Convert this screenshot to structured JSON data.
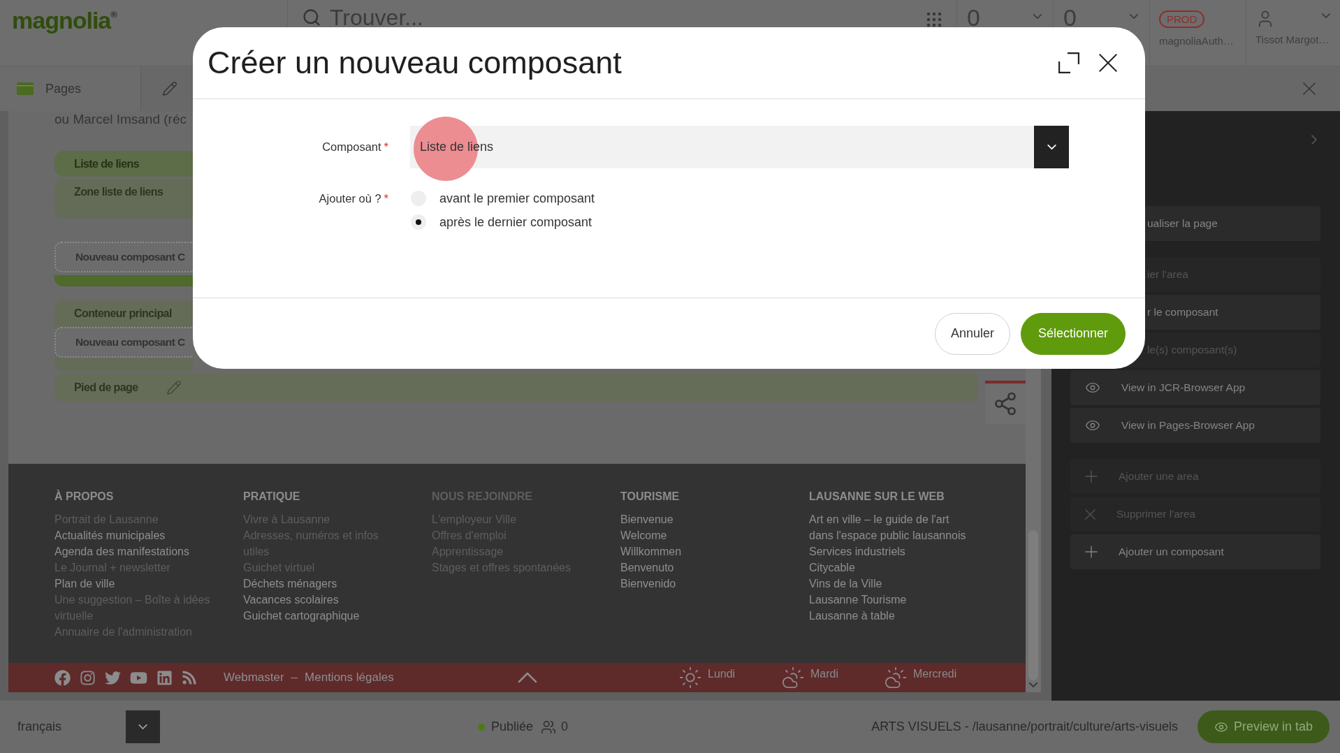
{
  "header": {
    "logo": "magnolia$^{®}$",
    "search": {
      "placeholder": "Trouver..."
    },
    "counters": [
      {
        "value": "0"
      },
      {
        "value": "0"
      }
    ],
    "environment": {
      "badge": "PROD",
      "account": "magnoliaAuth…"
    },
    "user": {
      "name": "Tissot Margot…"
    }
  },
  "tabs": [
    {
      "kind": "app",
      "label": "Pages"
    },
    {
      "kind": "edit"
    }
  ],
  "page_preview": {
    "intro_text": "ou Marcel Imsand (réc",
    "blocks": [
      {
        "kind": "component",
        "label": "Liste de liens"
      },
      {
        "kind": "area",
        "label": "Zone liste de liens"
      },
      {
        "kind": "placeholder",
        "label": "Nouveau composant C",
        "highlighted": true
      },
      {
        "kind": "area",
        "label": "Conteneur principal",
        "children": [
          {
            "kind": "placeholder",
            "label": "Nouveau composant C",
            "highlighted": false
          }
        ]
      },
      {
        "kind": "footer",
        "label": "Pied de page"
      }
    ],
    "footer": {
      "columns": [
        {
          "heading": "À PROPOS",
          "dimmed": false,
          "links": [
            {
              "text": "Portrait de Lausanne",
              "dimmed": true
            },
            {
              "text": "Actualités municipales",
              "dimmed": false
            },
            {
              "text": "Agenda des manifestations",
              "dimmed": false
            },
            {
              "text": "Le Journal + newsletter",
              "dimmed": true
            },
            {
              "text": "Plan de ville",
              "dimmed": false
            },
            {
              "text": "Une suggestion – Boîte à idées virtuelle",
              "dimmed": true
            },
            {
              "text": "Annuaire de l'administration",
              "dimmed": true
            }
          ]
        },
        {
          "heading": "PRATIQUE",
          "dimmed": false,
          "links": [
            {
              "text": "Vivre à Lausanne",
              "dimmed": true
            },
            {
              "text": "Adresses, numéros et infos utiles",
              "dimmed": true
            },
            {
              "text": "Guichet virtuel",
              "dimmed": true
            },
            {
              "text": "Déchets ménagers",
              "dimmed": false
            },
            {
              "text": "Vacances scolaires",
              "dimmed": false
            },
            {
              "text": "Guichet cartographique",
              "dimmed": false
            }
          ]
        },
        {
          "heading": "NOUS REJOINDRE",
          "dimmed": true,
          "links": [
            {
              "text": "L'employeur Ville",
              "dimmed": true
            },
            {
              "text": "Offres d'emploi",
              "dimmed": true
            },
            {
              "text": "Apprentissage",
              "dimmed": true
            },
            {
              "text": "Stages et offres spontanées",
              "dimmed": true
            }
          ]
        },
        {
          "heading": "TOURISME",
          "dimmed": false,
          "links": [
            {
              "text": "Bienvenue",
              "dimmed": false
            },
            {
              "text": "Welcome",
              "dimmed": false
            },
            {
              "text": "Willkommen",
              "dimmed": false
            },
            {
              "text": "Benvenuto",
              "dimmed": false
            },
            {
              "text": "Bienvenido",
              "dimmed": false
            }
          ]
        },
        {
          "heading": "LAUSANNE SUR LE WEB",
          "dimmed": false,
          "links": [
            {
              "text": "Art en ville – le guide de l'art dans l'espace public lausannois",
              "dimmed": false
            },
            {
              "text": "Services industriels",
              "dimmed": false
            },
            {
              "text": "Citycable",
              "dimmed": false
            },
            {
              "text": "Vins de la Ville",
              "dimmed": false
            },
            {
              "text": "Lausanne Tourisme",
              "dimmed": false
            },
            {
              "text": "Lausanne à table",
              "dimmed": false
            }
          ]
        }
      ]
    },
    "strip": {
      "links": [
        "Webmaster",
        "Mentions légales"
      ],
      "separator": "–",
      "weather": [
        {
          "day": "Lundi",
          "kind": "sun"
        },
        {
          "day": "Mardi",
          "kind": "cloud-sun"
        },
        {
          "day": "Mercredi",
          "kind": "cloud-sun"
        }
      ]
    }
  },
  "actions_panel": {
    "groups": [
      {
        "items": [
          {
            "label": "ualiser la page",
            "kind": "text",
            "disabled": false
          }
        ]
      },
      {
        "items": [
          {
            "label": "ier l'area",
            "kind": "text",
            "disabled": true
          },
          {
            "label": "r le composant",
            "kind": "text",
            "disabled": false
          },
          {
            "label": "le(s) composant(s)",
            "kind": "text",
            "disabled": true
          },
          {
            "label": "View in JCR-Browser App",
            "kind": "eye",
            "disabled": false
          },
          {
            "label": "View in Pages-Browser App",
            "kind": "eye",
            "disabled": false
          }
        ]
      },
      {
        "items": [
          {
            "label": "Ajouter une area",
            "kind": "add",
            "disabled": true
          },
          {
            "label": "Supprimer l'area",
            "kind": "remove",
            "disabled": true
          },
          {
            "label": "Ajouter un composant",
            "kind": "add",
            "disabled": false
          }
        ]
      }
    ]
  },
  "status_bar": {
    "language": "français",
    "status": {
      "label": "Publiée",
      "published": true
    },
    "users": "0",
    "path": "ARTS VISUELS - /lausanne/portrait/culture/arts-visuels",
    "preview_button": "Preview in tab"
  },
  "dialog": {
    "title": "Créer un nouveau composant",
    "fields": [
      {
        "kind": "select",
        "label": "Composant",
        "required_mark": "*",
        "value": "Liste de liens"
      },
      {
        "kind": "radio",
        "label": "Ajouter où ?",
        "required_mark": "*",
        "options": [
          {
            "label": "avant le premier composant",
            "selected": false
          },
          {
            "label": "après le dernier composant",
            "selected": true
          }
        ]
      }
    ],
    "buttons": [
      {
        "kind": "secondary",
        "label": "Annuler"
      },
      {
        "kind": "primary",
        "label": "Sélectionner"
      }
    ]
  }
}
